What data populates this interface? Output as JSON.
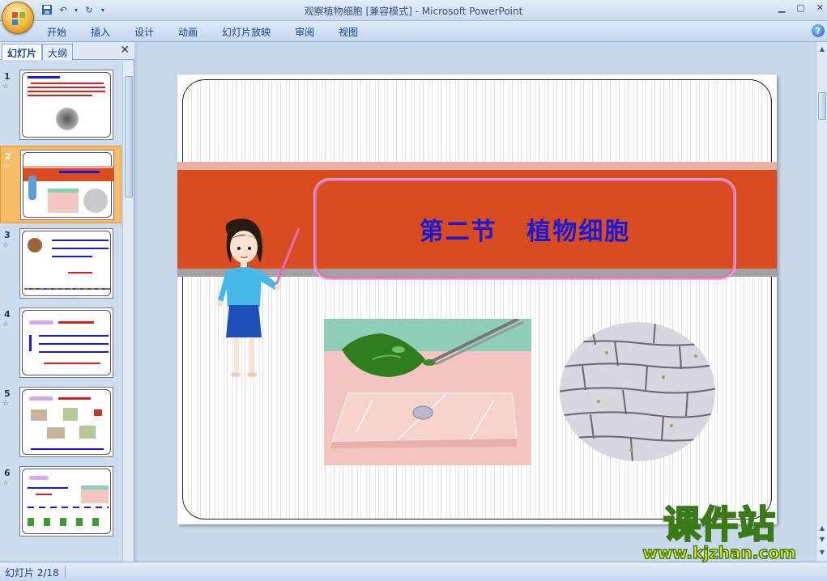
{
  "window": {
    "title": "观察植物细胞 [兼容模式] - Microsoft PowerPoint"
  },
  "ribbon": {
    "tabs": [
      "开始",
      "插入",
      "设计",
      "动画",
      "幻灯片放映",
      "审阅",
      "视图"
    ]
  },
  "left_pane": {
    "tabs": [
      "幻灯片",
      "大纲"
    ],
    "slides": [
      {
        "num": "1",
        "star": "☆",
        "selected": false
      },
      {
        "num": "2",
        "star": "☆",
        "selected": true
      },
      {
        "num": "3",
        "star": "☆",
        "selected": false
      },
      {
        "num": "4",
        "star": "☆",
        "selected": false
      },
      {
        "num": "5",
        "star": "☆",
        "selected": false
      },
      {
        "num": "6",
        "star": "☆",
        "selected": false
      }
    ]
  },
  "slide": {
    "title": "第二节 植物细胞"
  },
  "status": {
    "slide_counter": "幻灯片 2/18"
  },
  "watermark": {
    "brand": "课件站",
    "url": "www.kjzhan.com"
  },
  "colors": {
    "title_text": "#1a1ad6",
    "band_red": "#d94c1f",
    "selected_thumb": "#f7bc6a"
  }
}
